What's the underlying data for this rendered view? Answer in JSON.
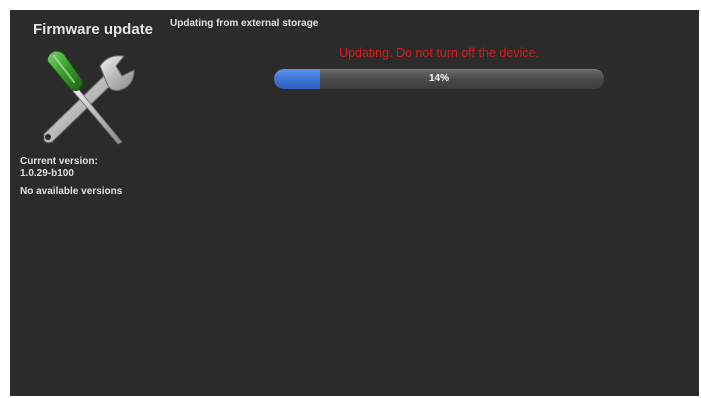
{
  "sidebar": {
    "title": "Firmware update",
    "icon": "wrench-screwdriver-icon",
    "current_version_label": "Current version:",
    "current_version_value": "1.0.29-b100",
    "available_versions_text": "No available versions"
  },
  "main": {
    "title": "Updating from external storage",
    "warning": "Updating. Do not turn off the device.",
    "progress": {
      "percent": 14,
      "label": "14%"
    }
  },
  "colors": {
    "background": "#2b2b2b",
    "warning": "#d81b1b",
    "progress_fill": "#3c72d2",
    "progress_track": "#4a4a4a",
    "screwdriver_handle": "#3a9a2e"
  }
}
